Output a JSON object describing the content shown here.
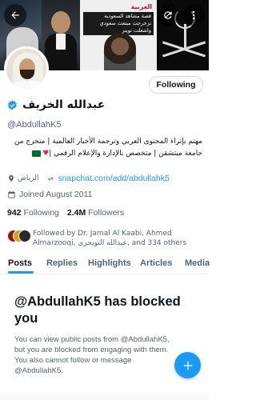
{
  "header": {
    "back_icon": "arrow-left-icon",
    "refresh_icon": "refresh-icon",
    "more_icon": "more-vertical-icon",
    "banner_headline": "قصة مشاهد السعودية تزخرجت مبتعث سعودي واشعلت تويتر",
    "banner_logo": "العربية"
  },
  "profile": {
    "follow_button_label": "Following",
    "display_name": "عبدالله الخريف",
    "verified_icon": "verified-badge-icon",
    "handle": "@AbdullahK5",
    "bio_line1": "مهتم بإثراء المحتوى العربي وترجمة الأخبار العالمية | متخرج من",
    "bio_line2": "جامعة ميتشقن | متخصص بالإدارة والإعلام الرقمي |",
    "location": "الرياض",
    "website": "snapchat.com/add/abdullahk5",
    "joined": "Joined August 2011",
    "following_count": "942",
    "following_label": "Following",
    "followers_count": "2.4M",
    "followers_label": "Followers",
    "followed_by_text": "Followed by Dr. Jamal Al Kaabi, Ahmed Almarzooqi, عبدالله التويجري, and 334 others"
  },
  "tabs": [
    {
      "label": "Posts",
      "active": true
    },
    {
      "label": "Replies",
      "active": false
    },
    {
      "label": "Highlights",
      "active": false
    },
    {
      "label": "Articles",
      "active": false
    },
    {
      "label": "Media",
      "active": false
    }
  ],
  "blocked": {
    "title": "@AbdullahK5 has blocked you",
    "body": "You can view public posts from @AbdullahK5, but you are blocked from engaging with them. You also cannot follow or message @AbdullahK5."
  },
  "fab": {
    "icon": "plus-icon"
  },
  "colors": {
    "accent": "#1d9bf0",
    "text": "#0f1419",
    "secondary": "#536471"
  }
}
